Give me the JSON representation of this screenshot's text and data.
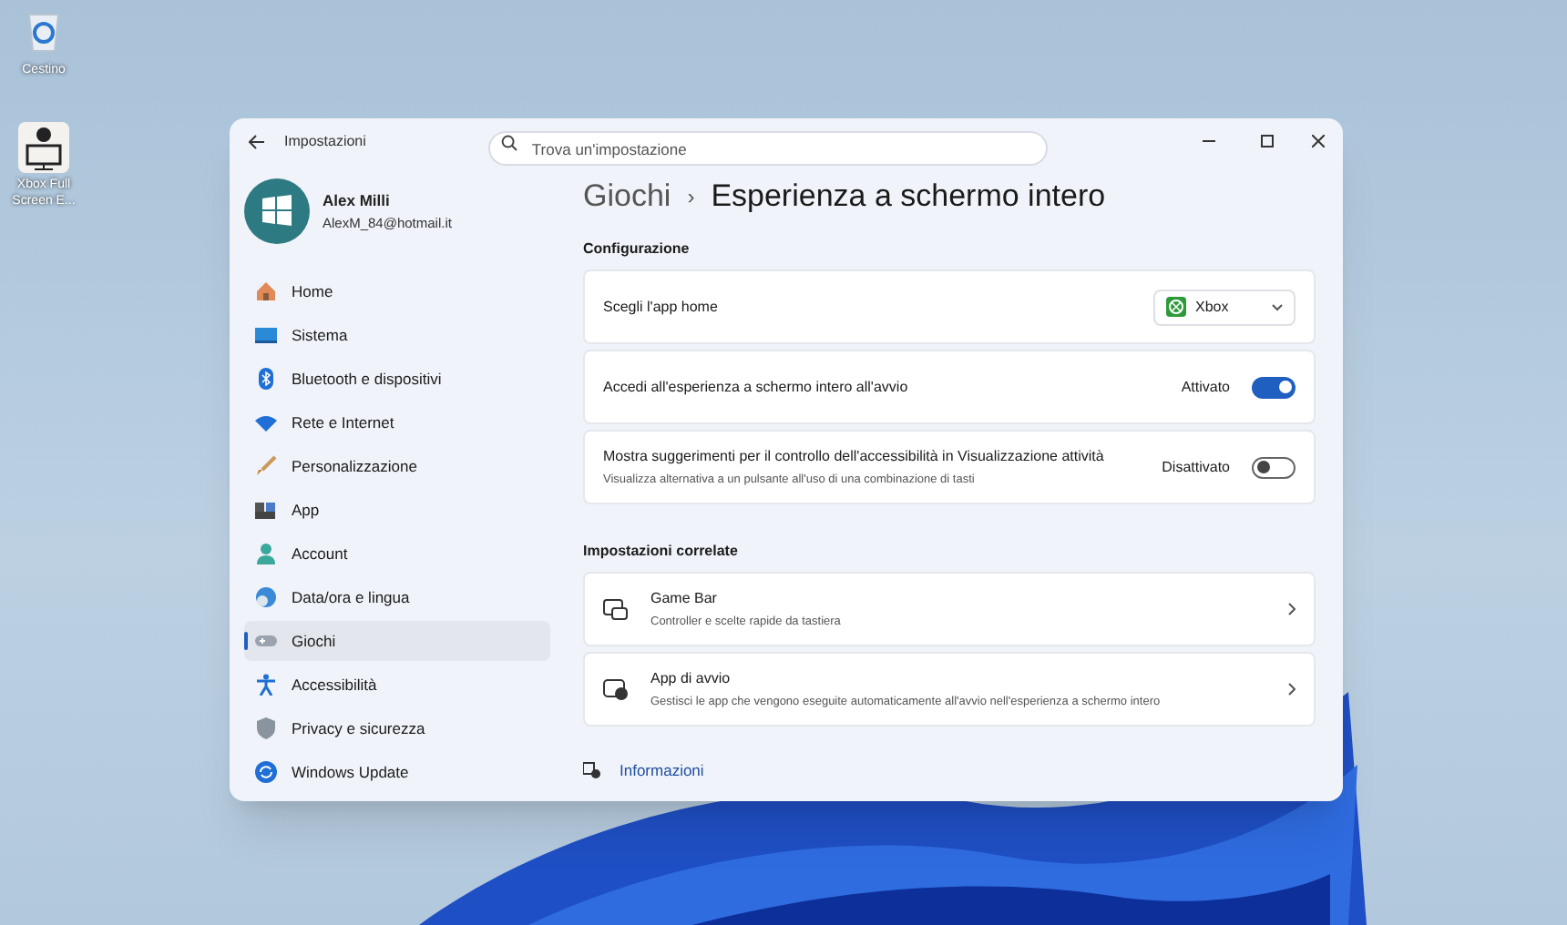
{
  "desktop_icons": [
    {
      "kind": "recycle",
      "label": "Cestino"
    },
    {
      "kind": "xbox",
      "label": "Xbox Full Screen E..."
    }
  ],
  "window": {
    "title": "Impostazioni",
    "search": {
      "placeholder": "Trova un'impostazione"
    }
  },
  "account": {
    "name": "Alex Milli",
    "email": "AlexM_84@hotmail.it"
  },
  "sidebar": {
    "items": [
      {
        "kind": "home",
        "label": "Home",
        "selected": false
      },
      {
        "kind": "system",
        "label": "Sistema",
        "selected": false
      },
      {
        "kind": "bluetooth",
        "label": "Bluetooth e dispositivi",
        "selected": false
      },
      {
        "kind": "wifi",
        "label": "Rete e Internet",
        "selected": false
      },
      {
        "kind": "brush",
        "label": "Personalizzazione",
        "selected": false
      },
      {
        "kind": "apps",
        "label": "App",
        "selected": false
      },
      {
        "kind": "account",
        "label": "Account",
        "selected": false
      },
      {
        "kind": "globe",
        "label": "Data/ora e lingua",
        "selected": false
      },
      {
        "kind": "gamepad",
        "label": "Giochi",
        "selected": true
      },
      {
        "kind": "accessibility",
        "label": "Accessibilità",
        "selected": false
      },
      {
        "kind": "shield",
        "label": "Privacy e sicurezza",
        "selected": false
      },
      {
        "kind": "update",
        "label": "Windows Update",
        "selected": false
      }
    ]
  },
  "breadcrumb": {
    "parent": "Giochi",
    "separator": "›",
    "current": "Esperienza a schermo intero"
  },
  "sections": [
    {
      "title": "Configurazione",
      "cards": [
        {
          "kind": "dropdown",
          "label": "Scegli l'app home",
          "value": "Xbox"
        },
        {
          "kind": "toggle",
          "label": "Accedi all'esperienza a schermo intero all'avvio",
          "state_text": "Attivato",
          "on": true
        },
        {
          "kind": "toggle",
          "label": "Mostra suggerimenti per il controllo dell'accessibilità in Visualizzazione attività",
          "description": "Visualizza alternativa a un pulsante all'uso di una combinazione di tasti",
          "state_text": "Disattivato",
          "on": false
        }
      ]
    },
    {
      "title": "Impostazioni correlate",
      "cards": [
        {
          "kind": "link",
          "label": "Game Bar",
          "description": "Controller e scelte rapide da tastiera"
        },
        {
          "kind": "link",
          "label": "App di avvio",
          "description": "Gestisci le app che vengono eseguite automaticamente all'avvio nell'esperienza a schermo intero"
        }
      ]
    }
  ],
  "footer_links": [
    {
      "label": "Informazioni"
    }
  ]
}
